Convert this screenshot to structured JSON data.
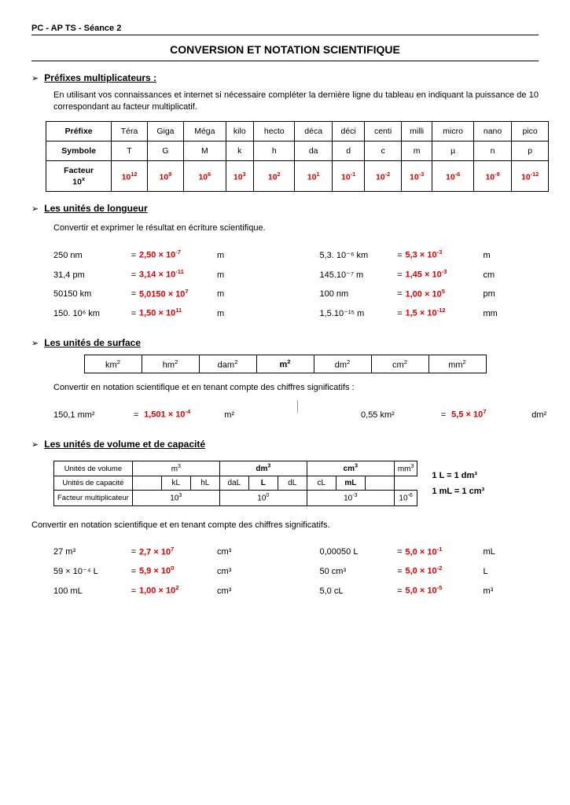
{
  "header": "PC -  AP TS - Séance 2",
  "title": "CONVERSION  ET NOTATION SCIENTIFIQUE",
  "sec1": {
    "label": "Préfixes multiplicateurs :",
    "text": "En utilisant vos connaissances et internet si nécessaire compléter la dernière ligne du tableau en indiquant  la puissance de 10 correspondant au facteur multiplicatif.",
    "rows": {
      "r1": "Préfixe",
      "r2": "Symbole",
      "r3a": "Facteur",
      "r3b": "10",
      "r3exp": "x"
    },
    "names": [
      "Téra",
      "Giga",
      "Méga",
      "kilo",
      "hecto",
      "déca",
      "déci",
      "centi",
      "milli",
      "micro",
      "nano",
      "pico"
    ],
    "symbols": [
      "T",
      "G",
      "M",
      "k",
      "h",
      "da",
      "d",
      "c",
      "m",
      "µ",
      "n",
      "p"
    ],
    "exps": [
      "12",
      "9",
      "6",
      "3",
      "2",
      "1",
      "-1",
      "-2",
      "-3",
      "-6",
      "-9",
      "-12"
    ]
  },
  "sec2": {
    "label": "Les unités de longueur",
    "intro": "Convertir et exprimer le résultat en écriture scientifique.",
    "left": [
      {
        "lhs": "250  nm",
        "ans": "2,50 × 10",
        "exp": "-7",
        "unit": "m"
      },
      {
        "lhs": "31,4  pm",
        "ans": "3,14 × 10",
        "exp": "-11",
        "unit": "m"
      },
      {
        "lhs": "50150  km",
        "ans": "5,0150 × 10",
        "exp": "7",
        "unit": "m"
      },
      {
        "lhs": "150. 10⁶ km",
        "ans": "1,50 × 10",
        "exp": "11",
        "unit": "m"
      }
    ],
    "right": [
      {
        "lhs": "5,3. 10⁻⁶ km",
        "ans": "5,3 × 10",
        "exp": "-3",
        "unit": "m"
      },
      {
        "lhs": "145.10⁻⁷ m",
        "ans": "1,45 × 10",
        "exp": "-3",
        "unit": "cm"
      },
      {
        "lhs": "100  nm",
        "ans": "1,00 × 10",
        "exp": "5",
        "unit": "pm"
      },
      {
        "lhs": "1,5.10⁻¹⁵ m",
        "ans": "1,5 × 10",
        "exp": "-12",
        "unit": "mm"
      }
    ]
  },
  "sec3": {
    "label": "Les unités de surface",
    "units": [
      "km",
      "hm",
      "dam",
      "m",
      "dm",
      "cm",
      "mm"
    ],
    "sq": "2",
    "intro": "Convertir en notation scientifique et en tenant compte des chiffres significatifs :",
    "left": {
      "lhs": "150,1  mm²",
      "ans": "1,501 × 10",
      "exp": "-4",
      "unit": "m²"
    },
    "right": {
      "lhs": "0,55  km²",
      "ans": "5,5 × 10",
      "exp": "7",
      "unit": "dm²"
    }
  },
  "sec4": {
    "label": "Les unités de volume et de capacité",
    "hdr1": "Unités de volume",
    "hdr2": "Unités de capacité",
    "hdr3": "Facteur multiplicateur",
    "vols": [
      "m",
      "dm",
      "cm",
      "mm"
    ],
    "cu": "3",
    "caps": [
      "",
      "kL",
      "hL",
      "daL",
      "L",
      "dL",
      "cL",
      "mL",
      ""
    ],
    "facs": [
      "10",
      "10",
      "10",
      "10"
    ],
    "facexp": [
      "3",
      "0",
      "-3",
      "-6"
    ],
    "eq1": "1 L = 1 dm³",
    "eq2": "1 mL = 1 cm³",
    "intro": "Convertir en notation scientifique et en tenant compte des chiffres significatifs.",
    "left": [
      {
        "lhs": "27 m³",
        "ans": "2,7 × 10",
        "exp": "7",
        "unit": "cm³"
      },
      {
        "lhs": "59 × 10⁻⁴ L",
        "ans": "5,9 × 10",
        "exp": "0",
        "unit": "cm³"
      },
      {
        "lhs": "100 mL",
        "ans": "1,00 × 10",
        "exp": "2",
        "unit": "cm³"
      }
    ],
    "right": [
      {
        "lhs": "0,00050 L",
        "ans": "5,0 × 10",
        "exp": "-1",
        "unit": "mL"
      },
      {
        "lhs": "50 cm³",
        "ans": "5,0 × 10",
        "exp": "-2",
        "unit": "L"
      },
      {
        "lhs": "5,0 cL",
        "ans": "5,0 × 10",
        "exp": "-5",
        "unit": "m³"
      }
    ]
  },
  "chart_data": {
    "type": "table",
    "title": "SI prefix multipliers",
    "prefixes": [
      "Téra",
      "Giga",
      "Méga",
      "kilo",
      "hecto",
      "déca",
      "déci",
      "centi",
      "milli",
      "micro",
      "nano",
      "pico"
    ],
    "symbols": [
      "T",
      "G",
      "M",
      "k",
      "h",
      "da",
      "d",
      "c",
      "m",
      "µ",
      "n",
      "p"
    ],
    "power_of_10": [
      12,
      9,
      6,
      3,
      2,
      1,
      -1,
      -2,
      -3,
      -6,
      -9,
      -12
    ]
  }
}
